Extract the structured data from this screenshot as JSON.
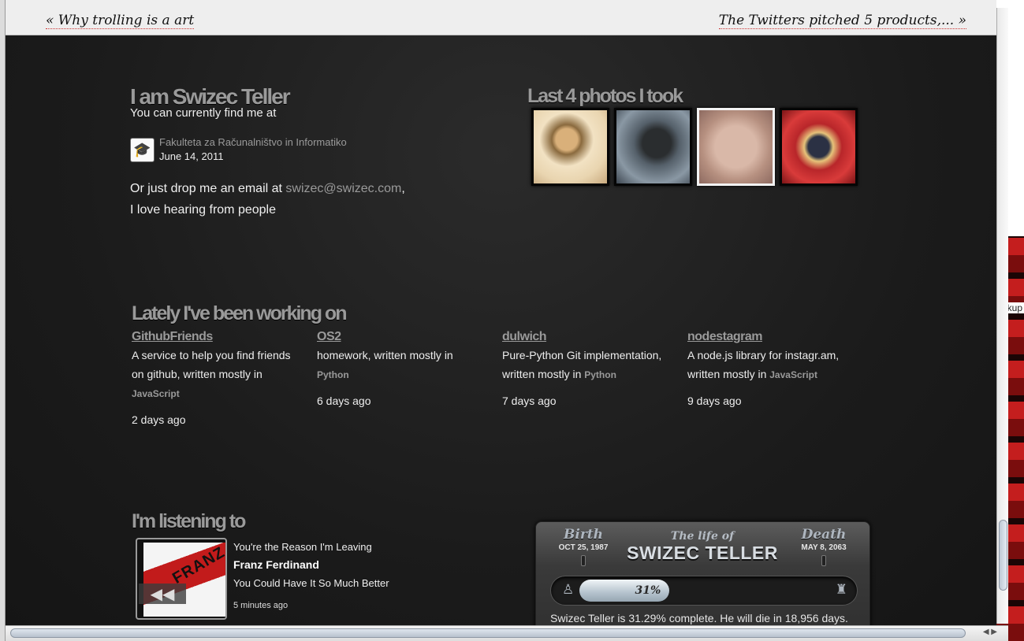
{
  "nav": {
    "prev": "« Why trolling is a art",
    "next": "The Twitters pitched 5 products,... »"
  },
  "intro": {
    "title": "I am Swizec Teller",
    "subtitle": "You can currently find me at",
    "checkin_icon": "graduation-cap-icon",
    "place": "Fakulteta za Računalništvo in Informatiko",
    "date": "June 14, 2011",
    "email_prefix": "Or just drop me an email at",
    "email": "swizec@swizec.com",
    "email_suffix": ",",
    "closing": "I love hearing from people"
  },
  "photos": {
    "title": "Last 4 photos I took",
    "count": 4,
    "selected_index": 2
  },
  "projects": {
    "title": "Lately I've been working on",
    "items": [
      {
        "name": "GithubFriends",
        "desc": "A service to help you find friends on github, written mostly in",
        "lang": "JavaScript",
        "time": "2 days ago"
      },
      {
        "name": "OS2",
        "desc": "homework, written mostly in",
        "lang": "Python",
        "time": "6 days ago"
      },
      {
        "name": "dulwich",
        "desc": "Pure-Python Git implementation, written mostly in",
        "lang": "Python",
        "time": "7 days ago"
      },
      {
        "name": "nodestagram",
        "desc": "A node.js library for instagr.am, written mostly in",
        "lang": "JavaScript",
        "time": "9 days ago"
      }
    ]
  },
  "listening": {
    "title": "I'm listening to",
    "track": "You're the Reason I'm Leaving",
    "artist": "Franz Ferdinand",
    "album": "You Could Have It So Much Better",
    "time": "5 minutes ago",
    "album_art_text": "FRANZ"
  },
  "life": {
    "birth_label": "Birth",
    "birth_date": "OCT 25, 1987",
    "death_label": "Death",
    "death_date": "MAY 8, 2063",
    "life_of": "The life of",
    "name": "SWIZEC TELLER",
    "percent_label": "31%",
    "progress": 0.3129,
    "summary": "Swizec Teller is 31.29% complete. He will die in 18,956 days."
  },
  "side": {
    "text": "kup"
  },
  "colors": {
    "background": "#1b1b1b",
    "muted": "#9a9a9a",
    "text": "#f2f2f2",
    "link_underline": "#cc3333"
  }
}
